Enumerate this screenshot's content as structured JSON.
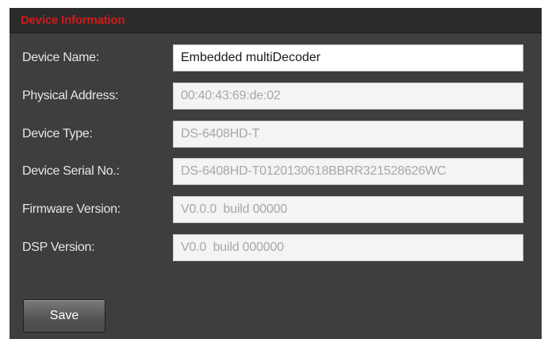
{
  "section": {
    "title": "Device Information",
    "title_color": "#d21a1a"
  },
  "fields": [
    {
      "label": "Device Name:",
      "value": "Embedded multiDecoder",
      "editable": true
    },
    {
      "label": "Physical Address:",
      "value": "00:40:43:69:de:02",
      "editable": false
    },
    {
      "label": "Device Type:",
      "value": "DS-6408HD-T",
      "editable": false
    },
    {
      "label": "Device Serial No.:",
      "value": "DS-6408HD-T0120130618BBRR321528626WC",
      "editable": false
    },
    {
      "label": "Firmware Version:",
      "value": "V0.0.0  build 00000",
      "editable": false
    },
    {
      "label": "DSP Version:",
      "value": "V0.0  build 000000",
      "editable": false
    }
  ],
  "actions": {
    "save_label": "Save"
  },
  "colors": {
    "panel_background": "#3e3e3e",
    "header_background": "#2b2b2b",
    "label_text": "#e6e6e6",
    "readonly_text": "#a7a7a7"
  }
}
